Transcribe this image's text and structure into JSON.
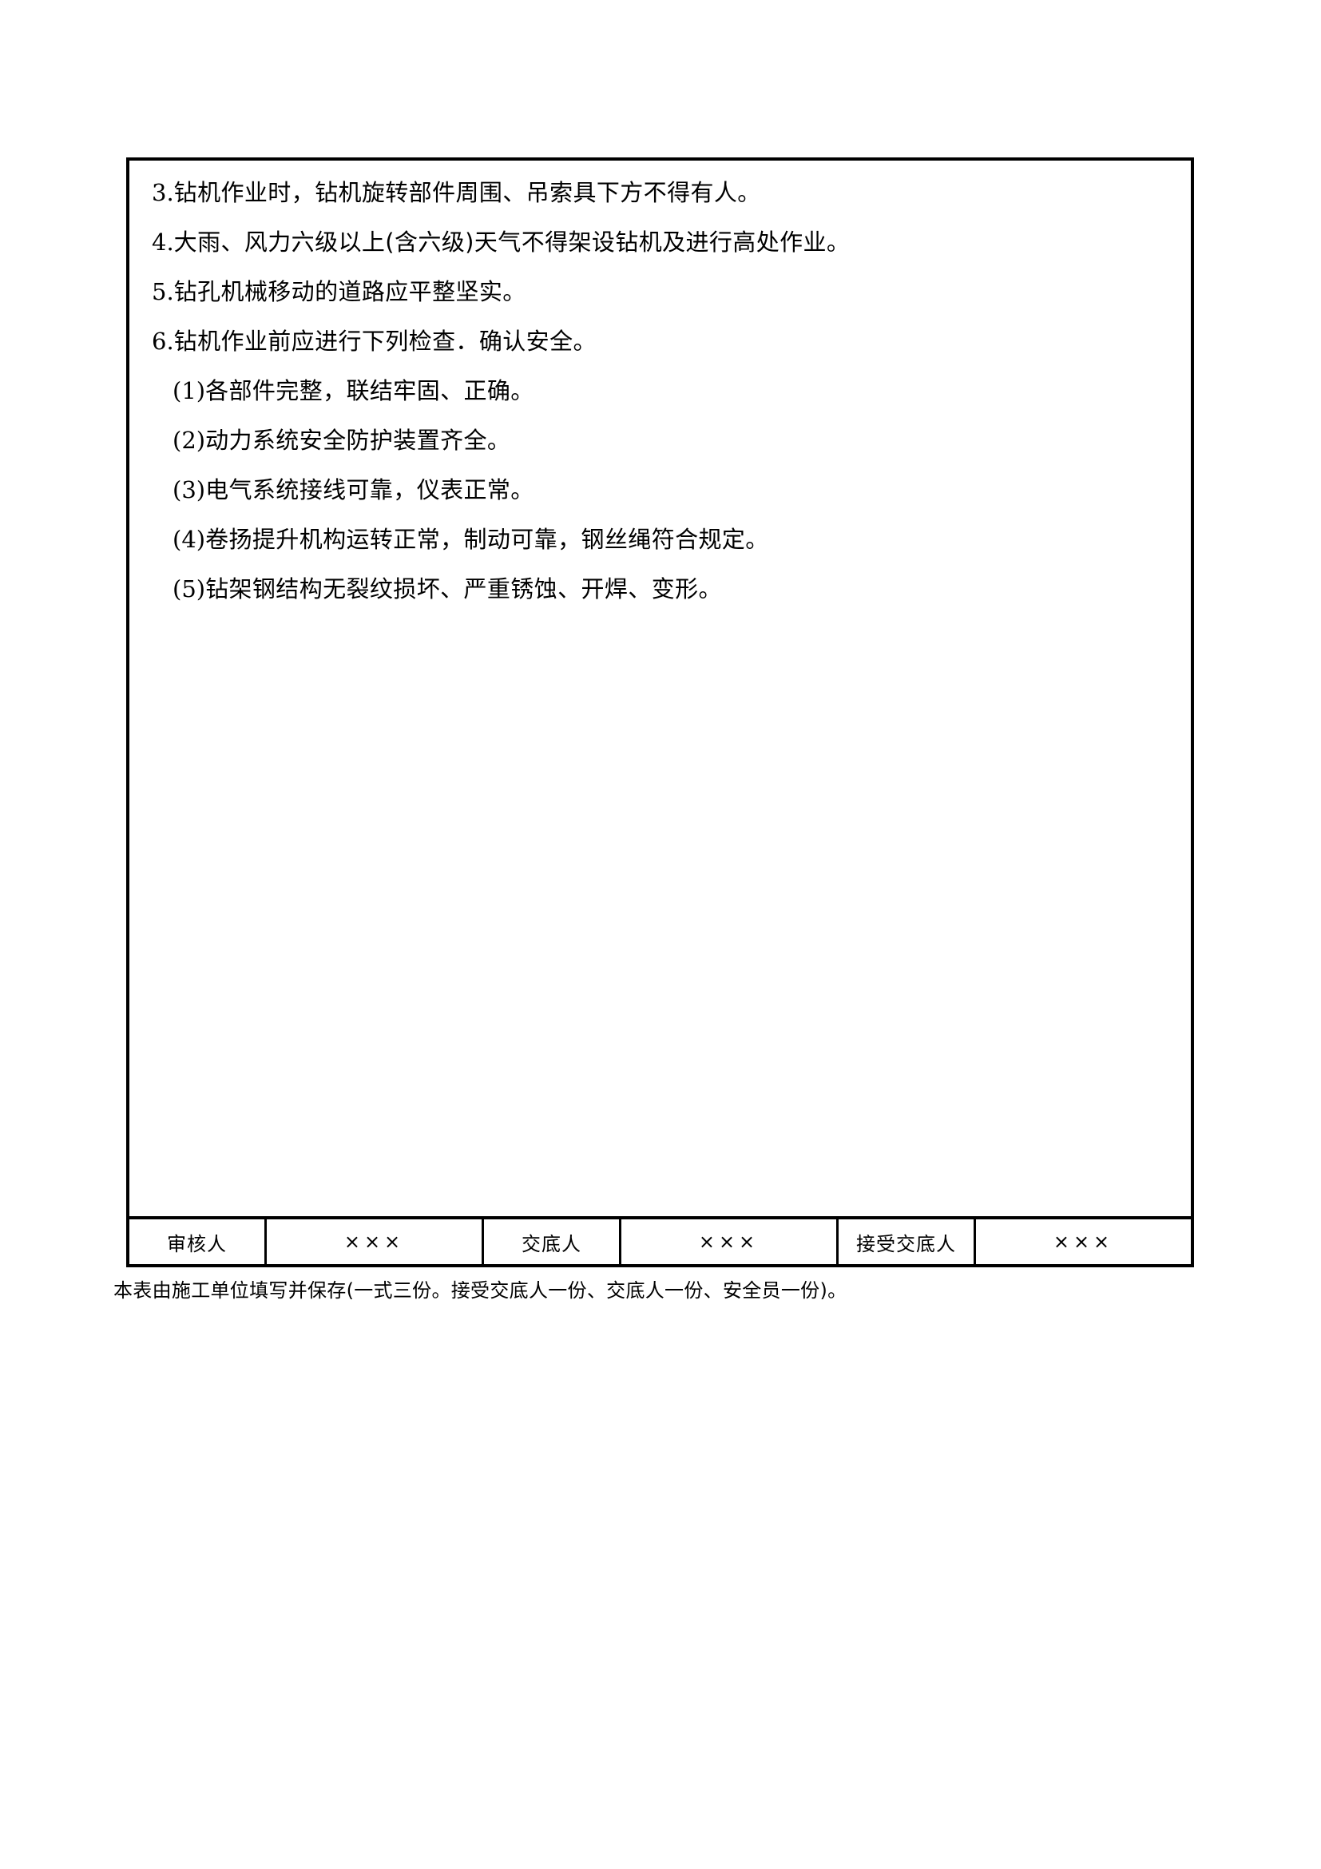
{
  "document": {
    "body_clauses": [
      {
        "id": "clause-3",
        "level": "top",
        "num": "3.",
        "text": "钻机作业时，钻机旋转部件周围、吊索具下方不得有人。"
      },
      {
        "id": "clause-4",
        "level": "top",
        "num": "4.",
        "text": "大雨、风力六级以上(含六级)天气不得架设钻机及进行高处作业。"
      },
      {
        "id": "clause-5",
        "level": "top",
        "num": "5.",
        "text": "钻孔机械移动的道路应平整坚实。"
      },
      {
        "id": "clause-6",
        "level": "top",
        "num": "6.",
        "text": "钻机作业前应进行下列检查．确认安全。"
      },
      {
        "id": "clause-6-1",
        "level": "sub",
        "num": "(1)",
        "text": "各部件完整，联结牢固、正确。"
      },
      {
        "id": "clause-6-2",
        "level": "sub",
        "num": "(2)",
        "text": "动力系统安全防护装置齐全。"
      },
      {
        "id": "clause-6-3",
        "level": "sub",
        "num": "(3)",
        "text": "电气系统接线可靠，仪表正常。"
      },
      {
        "id": "clause-6-4",
        "level": "sub",
        "num": "(4)",
        "text": "卷扬提升机构运转正常，制动可靠，钢丝绳符合规定。"
      },
      {
        "id": "clause-6-5",
        "level": "sub",
        "num": "(5)",
        "text": "钻架钢结构无裂纹损坏、严重锈蚀、开焊、变形。"
      }
    ],
    "signature_row": {
      "reviewer_label": "审核人",
      "reviewer_value": "×××",
      "presenter_label": "交底人",
      "presenter_value": "×××",
      "receiver_label": "接受交底人",
      "receiver_value": "×××"
    },
    "footer_note": "本表由施工单位填写并保存(一式三份。接受交底人一份、交底人一份、安全员一份)。"
  }
}
